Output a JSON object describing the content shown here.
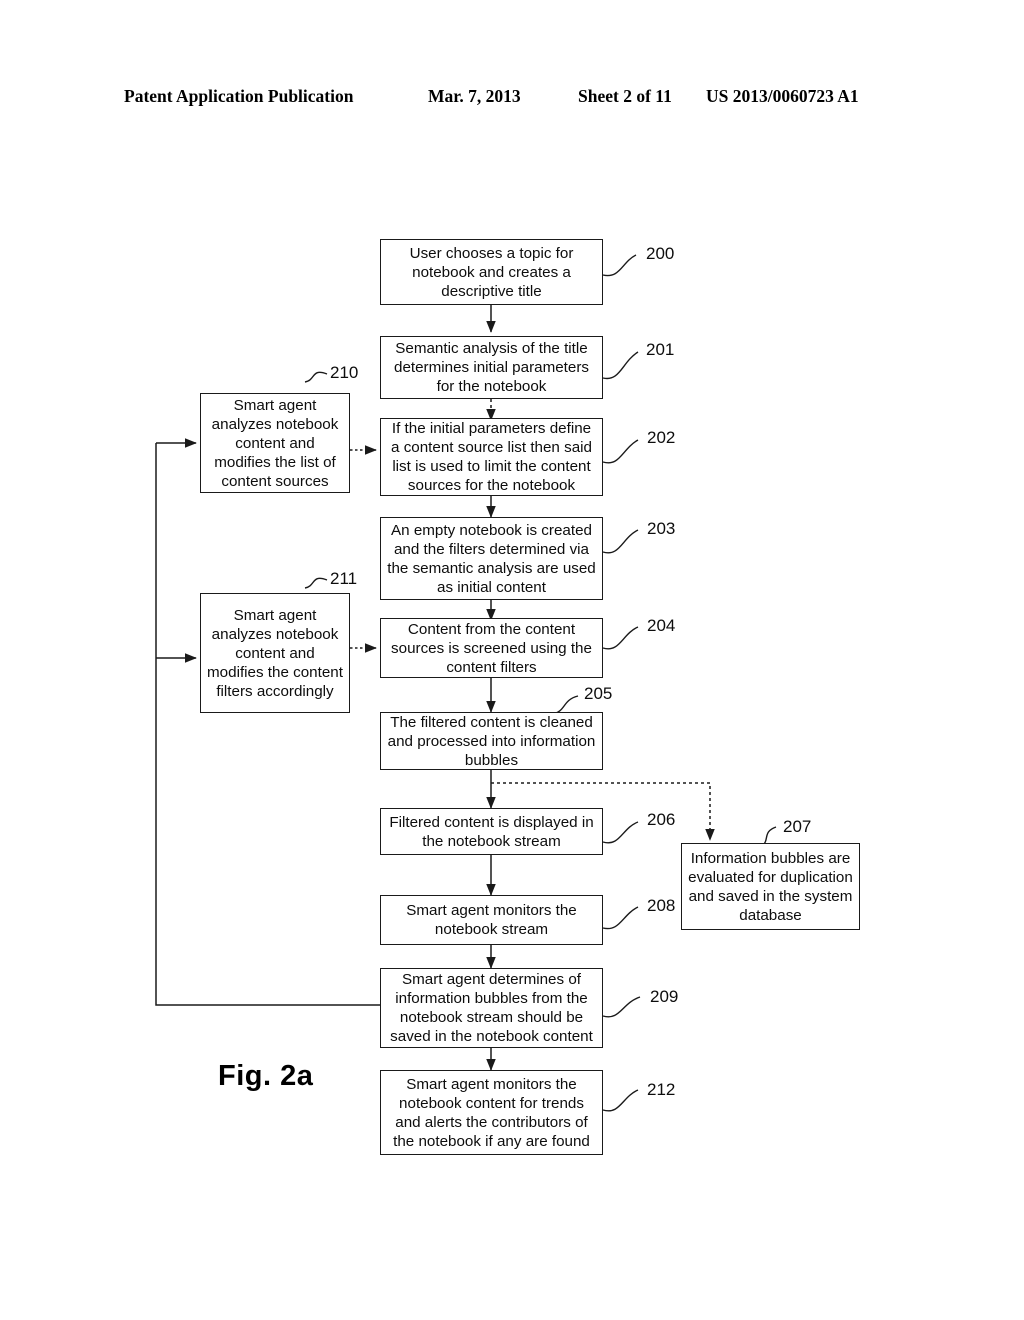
{
  "header": {
    "publication": "Patent Application Publication",
    "date": "Mar. 7, 2013",
    "sheet": "Sheet 2 of 11",
    "number": "US 2013/0060723 A1"
  },
  "figure": {
    "caption": "Fig. 2a",
    "nodes": [
      {
        "id": "200",
        "text": "User chooses a topic for notebook and creates a descriptive title"
      },
      {
        "id": "201",
        "text": "Semantic analysis of the title determines initial parameters for the notebook"
      },
      {
        "id": "202",
        "text": "If the initial parameters define a content source list then said list is used to limit the content sources for the notebook"
      },
      {
        "id": "203",
        "text": "An empty notebook is created and the filters determined via the semantic analysis are used as initial content"
      },
      {
        "id": "204",
        "text": "Content from the content sources is screened using the content filters"
      },
      {
        "id": "205",
        "text": "The filtered content is cleaned and processed into information bubbles"
      },
      {
        "id": "206",
        "text": "Filtered content is displayed in the notebook stream"
      },
      {
        "id": "207",
        "text": "Information bubbles are evaluated for duplication and saved in the system database"
      },
      {
        "id": "208",
        "text": "Smart agent monitors the notebook stream"
      },
      {
        "id": "209",
        "text": "Smart agent determines of information bubbles from the notebook stream should be saved in the notebook content"
      },
      {
        "id": "210",
        "text": "Smart agent analyzes notebook content and modifies the list of content sources"
      },
      {
        "id": "211",
        "text": "Smart agent analyzes notebook content and modifies the content filters accordingly"
      },
      {
        "id": "212",
        "text": "Smart agent monitors the notebook content for trends and alerts the contributors of the notebook if any are found"
      }
    ],
    "labels": {
      "n200": "200",
      "n201": "201",
      "n202": "202",
      "n203": "203",
      "n204": "204",
      "n205": "205",
      "n206": "206",
      "n207": "207",
      "n208": "208",
      "n209": "209",
      "n210": "210",
      "n211": "211",
      "n212": "212"
    },
    "colors": {
      "ink": "#0d0d0d",
      "background": "#ffffff"
    }
  }
}
